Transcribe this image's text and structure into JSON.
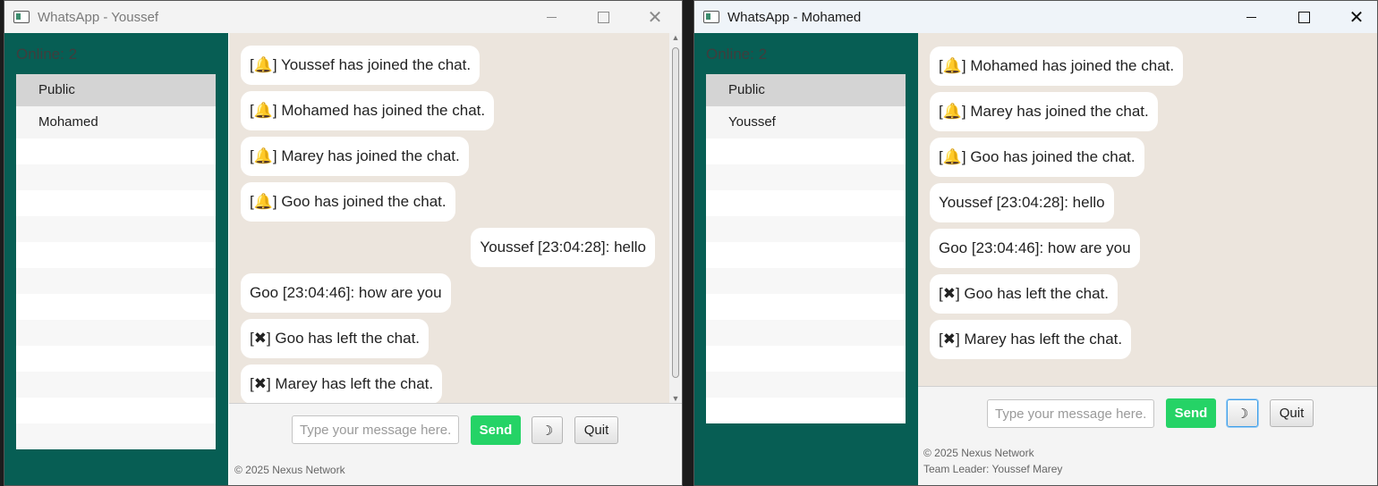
{
  "windows": [
    {
      "title": "WhatsApp - Youssef",
      "online": "Online: 2",
      "users": [
        "Public",
        "Mohamed"
      ],
      "messages": [
        {
          "text": "[🔔] Youssef has joined the chat."
        },
        {
          "text": "[🔔] Mohamed has joined the chat."
        },
        {
          "text": "[🔔] Marey has joined the chat."
        },
        {
          "text": "[🔔] Goo has joined the chat."
        },
        {
          "text": "Youssef [23:04:28]: hello"
        },
        {
          "text": "Goo [23:04:46]: how are you"
        },
        {
          "text": "[✖] Goo has left the chat."
        },
        {
          "text": "[✖] Marey has left the chat."
        }
      ],
      "input_placeholder": "Type your message here..",
      "send_label": "Send",
      "theme_icon": "☽",
      "quit_label": "Quit",
      "footer": [
        "© 2025 Nexus Network"
      ]
    },
    {
      "title": "WhatsApp - Mohamed",
      "online": "Online: 2",
      "users": [
        "Public",
        "Youssef"
      ],
      "messages": [
        {
          "text": "[🔔] Mohamed has joined the chat."
        },
        {
          "text": "[🔔] Marey has joined the chat."
        },
        {
          "text": "[🔔] Goo has joined the chat."
        },
        {
          "text": "Youssef [23:04:28]: hello"
        },
        {
          "text": "Goo [23:04:46]: how are you"
        },
        {
          "text": "[✖] Goo has left the chat."
        },
        {
          "text": "[✖] Marey has left the chat."
        }
      ],
      "input_placeholder": "Type your message here..",
      "send_label": "Send",
      "theme_icon": "☽",
      "quit_label": "Quit",
      "footer": [
        "© 2025 Nexus Network",
        "Team Leader: Youssef Marey"
      ]
    }
  ],
  "window_controls": {
    "minimize": "—",
    "maximize": "☐",
    "close": "✕"
  },
  "colors": {
    "sidebar": "#075e54",
    "chat_bg": "#ece5dd",
    "send": "#25d366",
    "bubble": "#ffffff"
  }
}
